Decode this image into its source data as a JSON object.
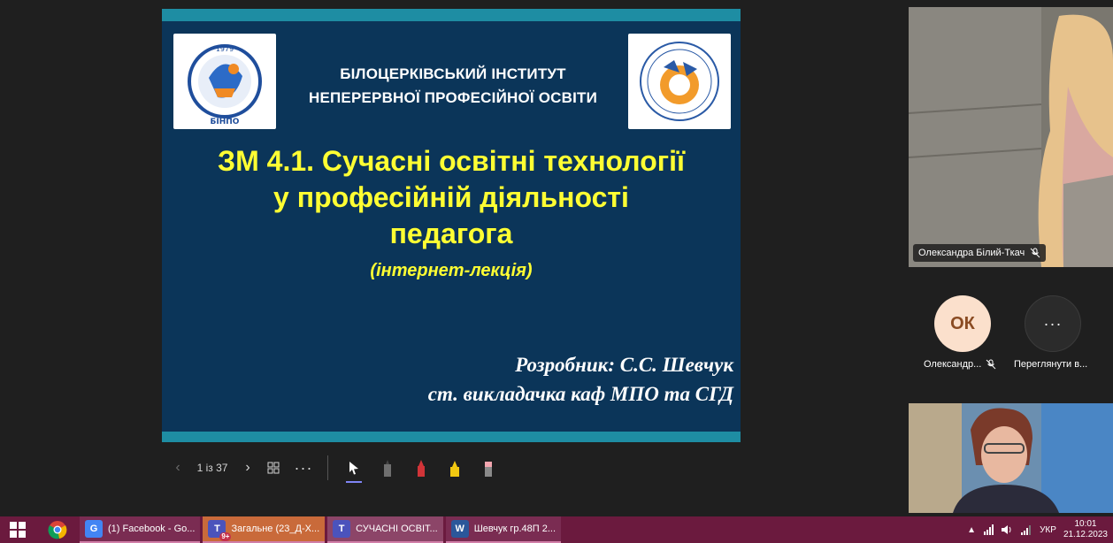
{
  "slide": {
    "institute_line1": "БІЛОЦЕРКІВСЬКИЙ ІНСТИТУТ",
    "institute_line2": "НЕПЕРЕРВНОЇ  ПРОФЕСІЙНОЇ ОСВІТИ",
    "title_line1": "ЗМ 4.1. Сучасні освітні  технології",
    "title_line2": "у  професійній діяльності",
    "title_line3": "педагога",
    "subtitle": "(інтернет-лекція)",
    "author_line1": "Розробник: С.С. Шевчук",
    "author_line2": "ст. викладачка каф МПО та СГД",
    "logo_left_text": "БІНПО",
    "logo_left_year": "1979",
    "colors": {
      "background": "#0b3559",
      "band": "#1e8da3",
      "title": "#ffff33"
    }
  },
  "controls": {
    "prev_icon": "‹",
    "page": "1 із 37",
    "next_icon": "›",
    "more": "···"
  },
  "participants": {
    "cam1_name": "Олександра Білий-Ткач",
    "avatar_initials": "ОК",
    "avatar_label": "Олександр...",
    "more_label": "Переглянути в...",
    "more_icon": "···"
  },
  "taskbar": {
    "items": [
      {
        "label": "(1) Facebook - Go..."
      },
      {
        "label": "Загальне (23_Д-Х...",
        "badge": "9+"
      },
      {
        "label": "СУЧАСНІ ОСВІТ..."
      },
      {
        "label": "Шевчук гр.48П 2..."
      }
    ],
    "tray_lang": "УКР",
    "time": "10:01",
    "date": "21.12.2023",
    "colors": {
      "bar": "#6b1a3e"
    }
  }
}
